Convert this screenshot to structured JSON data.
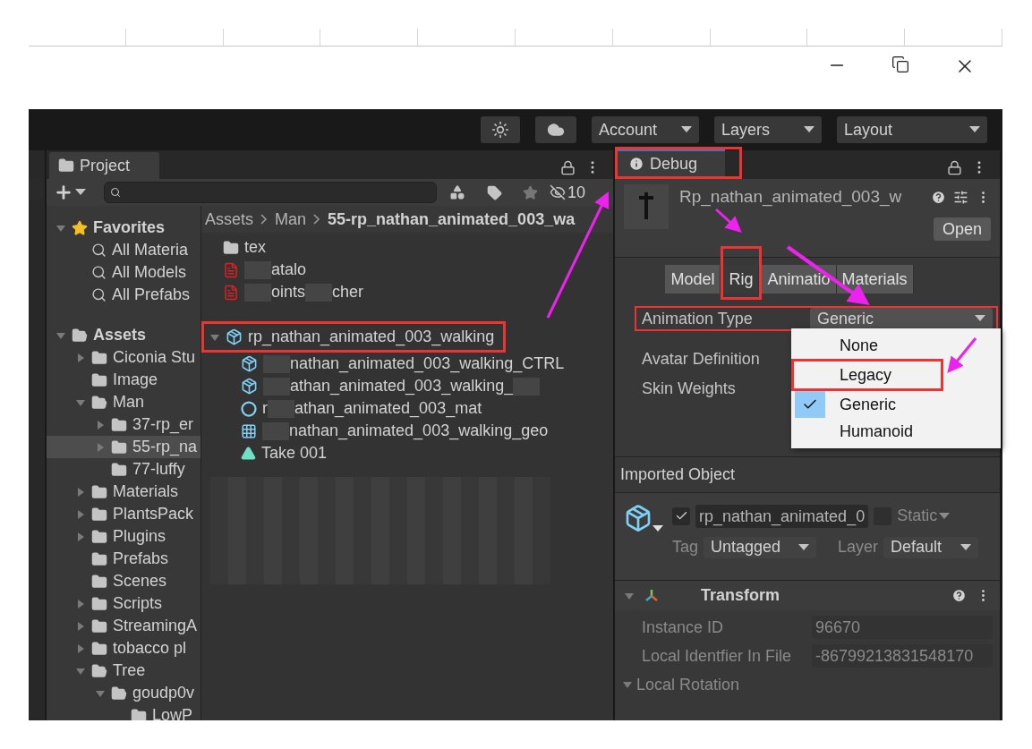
{
  "toolbar": {
    "dropdowns": [
      "Account",
      "Layers",
      "Layout"
    ]
  },
  "project": {
    "tab": "Project",
    "hidden_count": "10",
    "breadcrumb": [
      "Assets",
      "Man",
      "55-rp_nathan_animated_003_wa"
    ],
    "tree": [
      {
        "kind": "favorites",
        "label": "Favorites",
        "expanded": true,
        "selected": false,
        "children": [
          {
            "kind": "search",
            "label": "All Materia",
            "selected": false
          },
          {
            "kind": "search",
            "label": "All Models",
            "selected": false
          },
          {
            "kind": "search",
            "label": "All Prefabs",
            "selected": false
          }
        ]
      },
      {
        "kind": "folder",
        "label": "Assets",
        "expanded": true,
        "selected": false,
        "children": [
          {
            "kind": "folder",
            "label": "Ciconia Stu",
            "expanded": false,
            "selected": false
          },
          {
            "kind": "leaf",
            "label": "Image",
            "selected": false
          },
          {
            "kind": "folder",
            "label": "Man",
            "expanded": true,
            "selected": false,
            "children": [
              {
                "kind": "folder",
                "label": "37-rp_er",
                "expanded": false,
                "selected": false
              },
              {
                "kind": "folder",
                "label": "55-rp_na",
                "expanded": false,
                "selected": true
              },
              {
                "kind": "leaf",
                "label": "77-luffy",
                "selected": false
              }
            ]
          },
          {
            "kind": "folder",
            "label": "Materials",
            "expanded": false,
            "selected": false
          },
          {
            "kind": "folder",
            "label": "PlantsPack",
            "expanded": false,
            "selected": false
          },
          {
            "kind": "folder",
            "label": "Plugins",
            "expanded": false,
            "selected": false
          },
          {
            "kind": "leaf",
            "label": "Prefabs",
            "selected": false
          },
          {
            "kind": "leaf",
            "label": "Scenes",
            "selected": false
          },
          {
            "kind": "folder",
            "label": "Scripts",
            "expanded": false,
            "selected": false
          },
          {
            "kind": "folder",
            "label": "StreamingA",
            "expanded": false,
            "selected": false
          },
          {
            "kind": "folder",
            "label": "tobacco pl",
            "expanded": false,
            "selected": false
          },
          {
            "kind": "folder",
            "label": "Tree",
            "expanded": true,
            "selected": false,
            "children": [
              {
                "kind": "folder",
                "label": "goudp0v",
                "expanded": true,
                "selected": false,
                "children": [
                  {
                    "kind": "leaf",
                    "label": "LowP",
                    "selected": false
                  }
                ]
              }
            ]
          }
        ]
      }
    ],
    "files": [
      {
        "kind": "folder",
        "highlighted": false,
        "segments": [
          {
            "kind": "text",
            "text": "tex"
          }
        ]
      },
      {
        "kind": "pdf",
        "highlighted": false,
        "segments": [
          {
            "kind": "blur"
          },
          {
            "kind": "text",
            "text": "atalo"
          }
        ]
      },
      {
        "kind": "pdf",
        "highlighted": false,
        "segments": [
          {
            "kind": "blur"
          },
          {
            "kind": "text",
            "text": "oints"
          },
          {
            "kind": "blur"
          },
          {
            "kind": "text",
            "text": "cher"
          }
        ]
      },
      {
        "kind": "model",
        "highlighted": true,
        "expanded": true,
        "segments": [
          {
            "kind": "text",
            "text": "rp_nathan_animated_003_walking"
          }
        ],
        "children": [
          {
            "kind": "model",
            "highlighted": false,
            "segments": [
              {
                "kind": "blur"
              },
              {
                "kind": "text",
                "text": "nathan_animated_003_walking_CTRL"
              }
            ]
          },
          {
            "kind": "model",
            "highlighted": false,
            "segments": [
              {
                "kind": "blur"
              },
              {
                "kind": "text",
                "text": "athan_animated_003_walking_"
              },
              {
                "kind": "blur"
              }
            ]
          },
          {
            "kind": "material",
            "highlighted": false,
            "segments": [
              {
                "kind": "text",
                "text": "r"
              },
              {
                "kind": "blur"
              },
              {
                "kind": "text",
                "text": "athan_animated_003_mat"
              }
            ]
          },
          {
            "kind": "mesh",
            "highlighted": false,
            "segments": [
              {
                "kind": "blur"
              },
              {
                "kind": "text",
                "text": "nathan_animated_003_walking_geo"
              }
            ]
          },
          {
            "kind": "animation",
            "highlighted": false,
            "segments": [
              {
                "kind": "text",
                "text": "Take 001"
              }
            ]
          }
        ]
      }
    ]
  },
  "inspector": {
    "tab": "Debug",
    "tab_highlighted": true,
    "asset_title": "Rp_nathan_animated_003_w",
    "open_button": "Open",
    "tabs": [
      {
        "label": "Model",
        "selected": false,
        "highlighted": false
      },
      {
        "label": "Rig",
        "selected": true,
        "highlighted": true
      },
      {
        "label": "Animatio",
        "selected": false,
        "highlighted": false
      },
      {
        "label": "Materials",
        "selected": false,
        "highlighted": false
      }
    ],
    "animation_type": {
      "label": "Animation Type",
      "value": "Generic",
      "highlighted": true
    },
    "rows": [
      "Avatar Definition",
      "Skin Weights"
    ],
    "menu": [
      {
        "label": "None",
        "selected": false,
        "highlighted": false
      },
      {
        "label": "Legacy",
        "selected": false,
        "highlighted": true
      },
      {
        "label": "Generic",
        "selected": true,
        "highlighted": false
      },
      {
        "label": "Humanoid",
        "selected": false,
        "highlighted": false
      }
    ],
    "imported_object": {
      "title": "Imported Object",
      "active": true,
      "name": "rp_nathan_animated_0",
      "static": false,
      "static_label": "Static",
      "tag_label": "Tag",
      "tag": "Untagged",
      "layer_label": "Layer",
      "layer": "Default"
    },
    "transform": {
      "title": "Transform",
      "expanded": true,
      "fields": [
        {
          "label": "Instance ID",
          "value": "96670"
        },
        {
          "label": "Local Identfier In File",
          "value": "-86799213831548170"
        }
      ],
      "subsection": {
        "label": "Local Rotation",
        "expanded": true
      }
    }
  }
}
